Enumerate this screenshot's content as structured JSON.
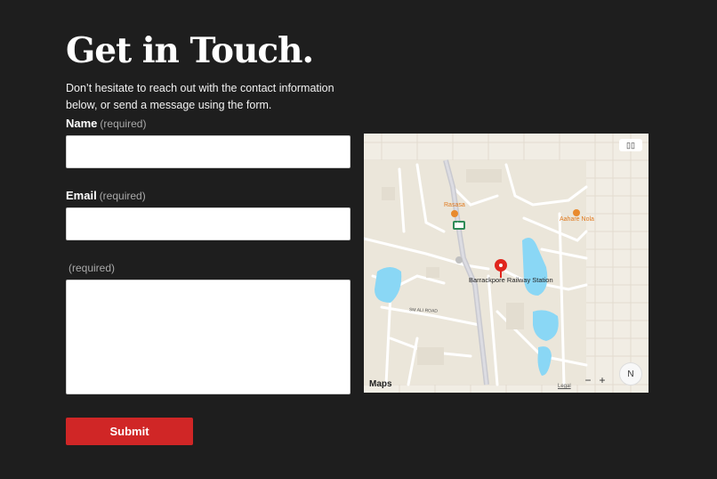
{
  "header": {
    "title": "Get in Touch.",
    "intro": "Don’t hesitate to reach out with the contact information below, or send a message using the form."
  },
  "form": {
    "name_label": "Name",
    "name_required": "(required)",
    "email_label": "Email",
    "email_required": "(required)",
    "message_label": "",
    "message_required": "(required)",
    "submit_label": "Submit"
  },
  "map": {
    "attribution": "Maps",
    "legal": "Legal",
    "zoom_out": "−",
    "zoom_in": "+",
    "compass": "N",
    "map_type_icon": "map-icon",
    "pois": {
      "rasasa": "Rasasa",
      "aahare_nola": "Aahare Nola",
      "station": "Barrackpore Railway Station",
      "road": "SM ALI ROAD",
      "route_badge": "1"
    },
    "colors": {
      "water": "#8ad7f5",
      "land": "#f1ede4",
      "road": "#ffffff",
      "rail": "#c9c9cf",
      "pin": "#e0261d"
    }
  },
  "colors": {
    "background": "#1e1e1e",
    "accent": "#d02626"
  }
}
